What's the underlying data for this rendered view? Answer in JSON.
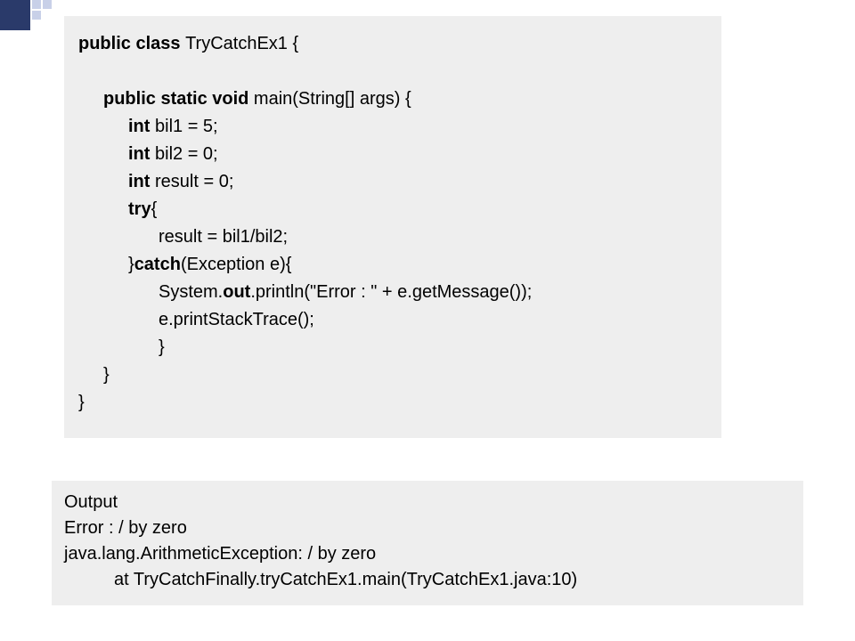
{
  "code": {
    "l1a": "public class ",
    "l1b": "TryCatchEx1 {",
    "l2a": "public static void ",
    "l2b": "main(String[] args) {",
    "l3a": "int ",
    "l3b": "bil1 = 5;",
    "l4a": "int ",
    "l4b": "bil2 = 0;",
    "l5a": "int ",
    "l5b": "result = 0;",
    "l6a": "try",
    "l6b": "{",
    "l7": "result = bil1/bil2;",
    "l8a": "}",
    "l8b": "catch",
    "l8c": "(Exception e){",
    "l9a": "System.",
    "l9b": "out",
    "l9c": ".println(\"Error : \" + e.getMessage());",
    "l10": "e.printStackTrace();",
    "l11": "}",
    "l12": "}",
    "l13": "}"
  },
  "output": {
    "l1": "Output",
    "l2": "Error : / by zero",
    "l3": "java.lang.ArithmeticException: / by zero",
    "l4": "at TryCatchFinally.tryCatchEx1.main(TryCatchEx1.java:10)"
  }
}
